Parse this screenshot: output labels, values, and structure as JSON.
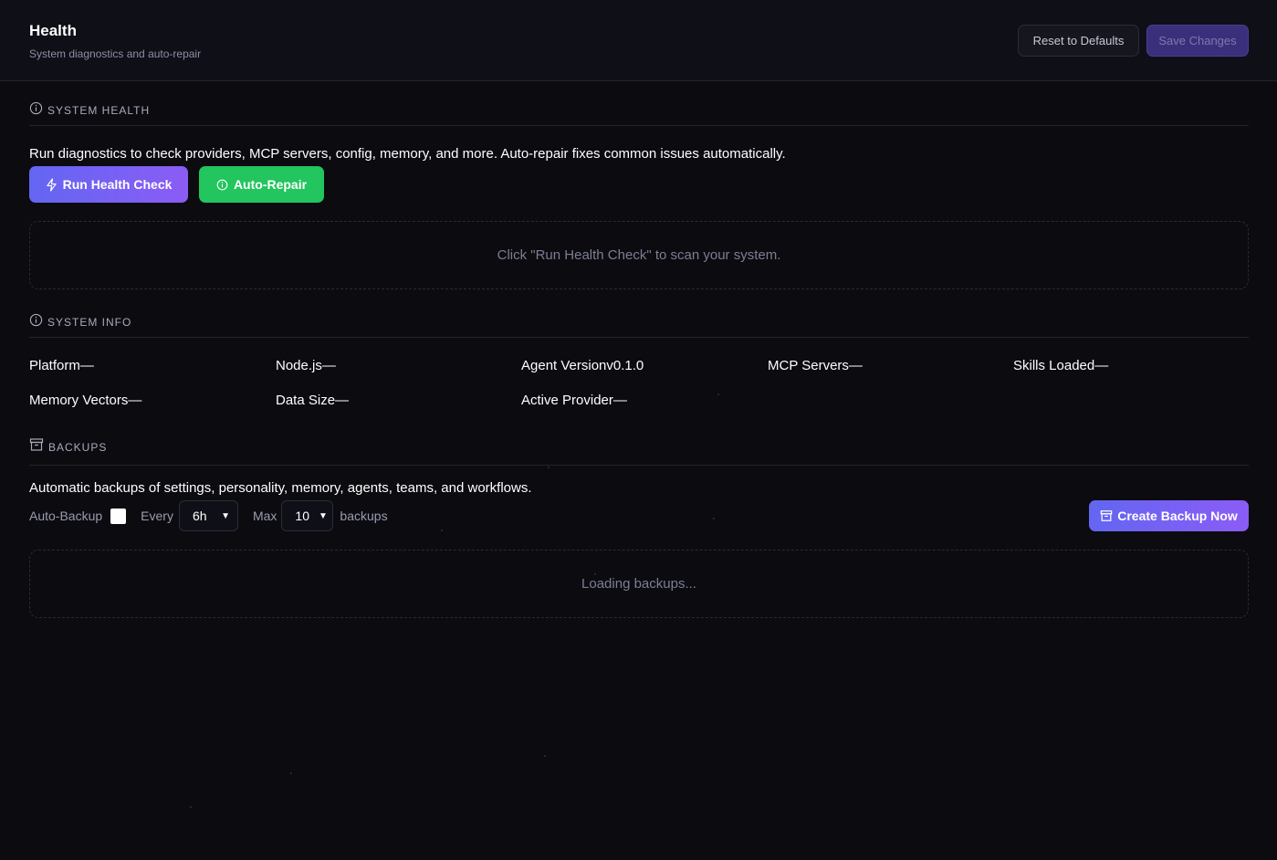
{
  "header": {
    "title": "Health",
    "subtitle": "System diagnostics and auto-repair",
    "reset_label": "Reset to Defaults",
    "save_label": "Save Changes"
  },
  "system_health": {
    "heading": "SYSTEM HEALTH",
    "description": "Run diagnostics to check providers, MCP servers, config, memory, and more. Auto-repair fixes common issues automatically.",
    "run_label": "Run Health Check",
    "repair_label": "Auto-Repair",
    "placeholder": "Click \"Run Health Check\" to scan your system."
  },
  "system_info": {
    "heading": "SYSTEM INFO",
    "items": [
      {
        "label": "Platform",
        "value": "—"
      },
      {
        "label": "Node.js",
        "value": "—"
      },
      {
        "label": "Agent Version",
        "value": "v0.1.0"
      },
      {
        "label": "MCP Servers",
        "value": "—"
      },
      {
        "label": "Skills Loaded",
        "value": "—"
      },
      {
        "label": "Memory Vectors",
        "value": "—"
      },
      {
        "label": "Data Size",
        "value": "—"
      },
      {
        "label": "Active Provider",
        "value": "—"
      }
    ]
  },
  "backups": {
    "heading": "BACKUPS",
    "description": "Automatic backups of settings, personality, memory, agents, teams, and workflows.",
    "auto_backup_label": "Auto-Backup",
    "auto_backup_checked": false,
    "every_label": "Every",
    "interval_value": "6h",
    "max_label": "Max",
    "max_value": "10",
    "backups_label": "backups",
    "create_label": "Create Backup Now",
    "loading_text": "Loading backups..."
  },
  "colors": {
    "accent": "#6366f1",
    "success": "#22c55e",
    "background": "#0b0b10"
  }
}
